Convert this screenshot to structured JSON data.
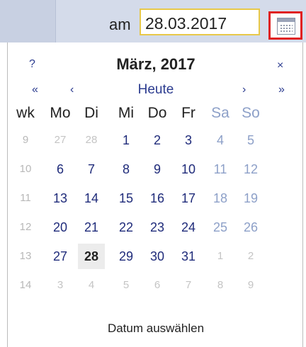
{
  "field": {
    "prefix": "am",
    "value": "28.03.2017"
  },
  "calendar": {
    "help": "?",
    "title": "März, 2017",
    "close": "×",
    "prev_year": "«",
    "prev_month": "‹",
    "today": "Heute",
    "next_month": "›",
    "next_year": "»",
    "headers": [
      "wk",
      "Mo",
      "Di",
      "Mi",
      "Do",
      "Fr",
      "Sa",
      "So"
    ],
    "weeks": [
      {
        "wk": "9",
        "days": [
          "27",
          "28",
          "1",
          "2",
          "3",
          "4",
          "5"
        ]
      },
      {
        "wk": "10",
        "days": [
          "6",
          "7",
          "8",
          "9",
          "10",
          "11",
          "12"
        ]
      },
      {
        "wk": "11",
        "days": [
          "13",
          "14",
          "15",
          "16",
          "17",
          "18",
          "19"
        ]
      },
      {
        "wk": "12",
        "days": [
          "20",
          "21",
          "22",
          "23",
          "24",
          "25",
          "26"
        ]
      },
      {
        "wk": "13",
        "days": [
          "27",
          "28",
          "29",
          "30",
          "31",
          "1",
          "2"
        ]
      },
      {
        "wk": "14",
        "days": [
          "3",
          "4",
          "5",
          "6",
          "7",
          "8",
          "9"
        ]
      }
    ],
    "selected": "28",
    "footer": "Datum auswählen"
  },
  "colors": {
    "accent": "#2b3b8f",
    "weekend": "#8da0c8",
    "input_border": "#e7c84a",
    "button_border": "#e02020"
  },
  "icons": {
    "calendar_button": "calendar-icon"
  }
}
